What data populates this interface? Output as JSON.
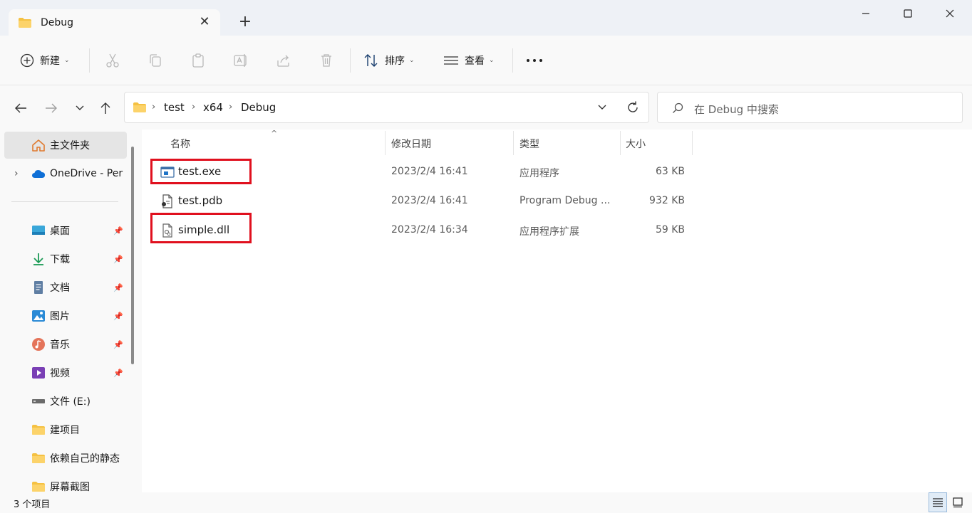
{
  "window": {
    "tab_title": "Debug",
    "new_tab_symbol": "+",
    "close_tab_symbol": "✕"
  },
  "toolbar": {
    "new_label": "新建",
    "sort_label": "排序",
    "view_label": "查看",
    "more_symbol": "···"
  },
  "address": {
    "crumbs": [
      "test",
      "x64",
      "Debug"
    ],
    "search_placeholder": "在 Debug 中搜索"
  },
  "sidebar": {
    "items": [
      {
        "label": "主文件夹",
        "icon": "home-icon",
        "pinned": false,
        "selected": true
      },
      {
        "label": "OneDrive - Per",
        "icon": "onedrive-cloud-icon",
        "pinned": false,
        "expandable": true
      },
      {
        "label": "桌面",
        "icon": "desktop-icon",
        "pinned": true
      },
      {
        "label": "下载",
        "icon": "download-icon",
        "pinned": true
      },
      {
        "label": "文档",
        "icon": "document-icon",
        "pinned": true
      },
      {
        "label": "图片",
        "icon": "picture-icon",
        "pinned": true
      },
      {
        "label": "音乐",
        "icon": "music-icon",
        "pinned": true
      },
      {
        "label": "视频",
        "icon": "video-icon",
        "pinned": true
      },
      {
        "label": "文件 (E:)",
        "icon": "drive-icon",
        "pinned": false
      },
      {
        "label": "建项目",
        "icon": "folder-icon",
        "pinned": false
      },
      {
        "label": "依赖自己的静态",
        "icon": "folder-icon",
        "pinned": false
      },
      {
        "label": "屏幕截图",
        "icon": "folder-icon",
        "pinned": false
      }
    ]
  },
  "columns": {
    "name": "名称",
    "date": "修改日期",
    "type": "类型",
    "size": "大小"
  },
  "files": [
    {
      "name": "test.exe",
      "date": "2023/2/4 16:41",
      "type": "应用程序",
      "size": "63 KB",
      "icon": "exe-icon",
      "highlighted": true
    },
    {
      "name": "test.pdb",
      "date": "2023/2/4 16:41",
      "type": "Program Debug ...",
      "size": "932 KB",
      "icon": "pdb-file-icon",
      "highlighted": false
    },
    {
      "name": "simple.dll",
      "date": "2023/2/4 16:34",
      "type": "应用程序扩展",
      "size": "59 KB",
      "icon": "dll-file-icon",
      "highlighted": true
    }
  ],
  "status": {
    "item_count": "3 个项目"
  },
  "colors": {
    "highlight": "#e0101e",
    "folder": "#f5c142",
    "accent": "#0067c0"
  }
}
